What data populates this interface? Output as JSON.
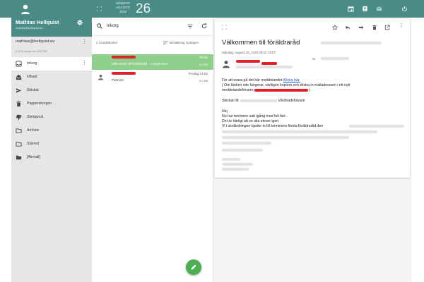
{
  "header": {
    "date_line1": "MÅNDAG",
    "date_line2": "AUGUSTI",
    "date_line3": "2019",
    "date_day": "26"
  },
  "account": {
    "name": "Mathias Hellquist",
    "email": "mathias@hellquist.eu",
    "address": "mathias@hellquist.eu",
    "quota": "0.41% använt av 1000 MB"
  },
  "sidebar": {
    "items": [
      {
        "label": "Inkorg",
        "icon": "inbox-icon"
      },
      {
        "label": "Utkast",
        "icon": "drafts-icon"
      },
      {
        "label": "Skickat",
        "icon": "send-icon"
      },
      {
        "label": "Papperskorgen",
        "icon": "trash-icon"
      },
      {
        "label": "Skräppost",
        "icon": "spam-icon"
      },
      {
        "label": "Archive",
        "icon": "folder-icon"
      },
      {
        "label": "Starred",
        "icon": "folder-icon"
      },
      {
        "label": "[Airmail]",
        "icon": "folder-filled-icon"
      }
    ]
  },
  "list": {
    "search_value": "Inkorg",
    "count": "2 meddelanden",
    "order": "Beställning mottagen",
    "messages": [
      {
        "subject": "Välkommen till föräldraråd …e september",
        "date": "09:02",
        "size": "4.2 KB"
      },
      {
        "subject": "Picknick!",
        "date": "Fredag 13:52",
        "size": "4.2 KB"
      }
    ]
  },
  "reader": {
    "title": "Välkommen till föräldraråd",
    "date": "Måndag, Augusti 26, 2019 09:02 CEST",
    "to_label": "Till:",
    "line1_prefix": "För att svara på det här meddelandet",
    "line1_link": "Klicka här.",
    "line2": "( Om länken inte fungerar, vänligen kopiera och klistra in mailadressen i ett nytt",
    "line3_prefix": "meddelandefönster:",
    "line3_suffix": ")",
    "sent_prefix": "Skickat till:",
    "sent_suffix": "Vårdnadshavare",
    "greeting": "Hej",
    "body1": "Nu har terminen satt igång med full fart.",
    "body2": "Det är härligt att se alla elever igen.",
    "body3": "Vi i skolledningen bjuder in till terminens första föräldraråd den"
  }
}
